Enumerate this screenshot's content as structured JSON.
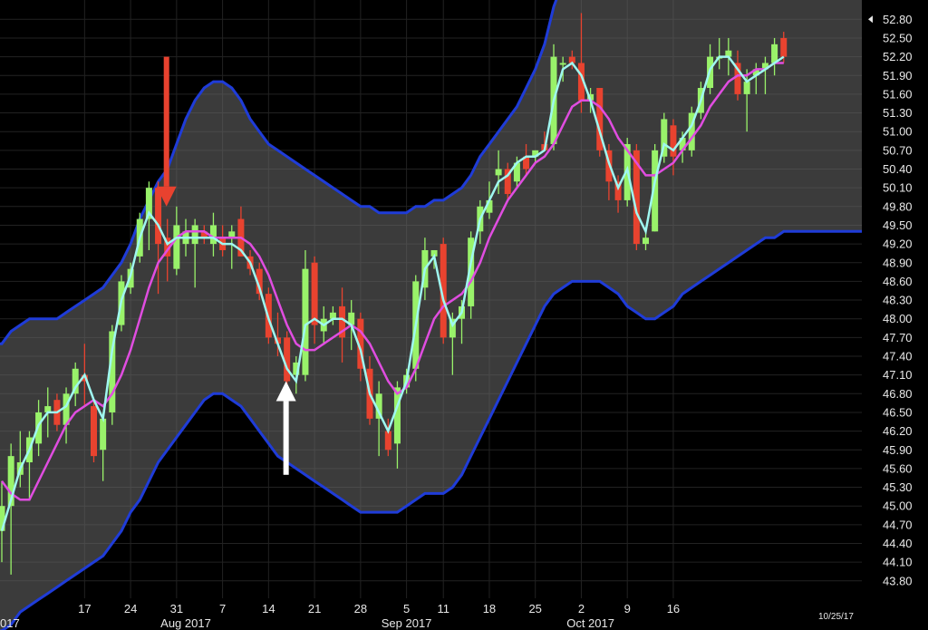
{
  "chart_data": {
    "type": "candlestick",
    "date_label": "10/25/17",
    "y_ticks": [
      "52.80",
      "52.50",
      "52.20",
      "51.90",
      "51.60",
      "51.30",
      "51.00",
      "50.70",
      "50.40",
      "50.10",
      "49.80",
      "49.50",
      "49.20",
      "48.90",
      "48.60",
      "48.30",
      "48.00",
      "47.70",
      "47.40",
      "47.10",
      "46.80",
      "46.50",
      "46.20",
      "45.90",
      "45.60",
      "45.30",
      "45.00",
      "44.70",
      "44.40",
      "44.10",
      "43.80"
    ],
    "ylim": [
      43.6,
      53.4
    ],
    "current_price": 52.8,
    "x_ticks": [
      {
        "label": "17",
        "day": 9
      },
      {
        "label": "24",
        "day": 14
      },
      {
        "label": "31",
        "day": 19
      },
      {
        "label": "7",
        "day": 24
      },
      {
        "label": "14",
        "day": 29
      },
      {
        "label": "21",
        "day": 34
      },
      {
        "label": "28",
        "day": 39
      },
      {
        "label": "5",
        "day": 44
      },
      {
        "label": "11",
        "day": 48
      },
      {
        "label": "18",
        "day": 53
      },
      {
        "label": "25",
        "day": 58
      },
      {
        "label": "2",
        "day": 63
      },
      {
        "label": "9",
        "day": 68
      },
      {
        "label": "16",
        "day": 73
      }
    ],
    "x_months": [
      {
        "label": "017",
        "day": 4
      },
      {
        "label": "Aug 2017",
        "day": 20
      },
      {
        "label": "Sep 2017",
        "day": 44
      },
      {
        "label": "Oct 2017",
        "day": 64
      }
    ],
    "candles": [
      {
        "o": 44.6,
        "h": 45.4,
        "l": 44.1,
        "c": 45.0,
        "up": true
      },
      {
        "o": 45.0,
        "h": 46.0,
        "l": 43.9,
        "c": 45.8,
        "up": true
      },
      {
        "o": 45.5,
        "h": 46.2,
        "l": 45.3,
        "c": 45.7,
        "up": true
      },
      {
        "o": 45.7,
        "h": 46.2,
        "l": 45.1,
        "c": 46.1,
        "up": true
      },
      {
        "o": 46.0,
        "h": 46.7,
        "l": 45.8,
        "c": 46.5,
        "up": true
      },
      {
        "o": 46.5,
        "h": 46.9,
        "l": 46.1,
        "c": 46.6,
        "up": true
      },
      {
        "o": 46.7,
        "h": 46.8,
        "l": 46.2,
        "c": 46.3,
        "up": false
      },
      {
        "o": 46.3,
        "h": 46.9,
        "l": 46.0,
        "c": 46.8,
        "up": true
      },
      {
        "o": 46.8,
        "h": 47.3,
        "l": 46.6,
        "c": 47.2,
        "up": true
      },
      {
        "o": 47.1,
        "h": 47.6,
        "l": 46.6,
        "c": 47.0,
        "up": false
      },
      {
        "o": 46.6,
        "h": 46.7,
        "l": 45.7,
        "c": 45.8,
        "up": false
      },
      {
        "o": 45.9,
        "h": 46.5,
        "l": 45.4,
        "c": 46.4,
        "up": true
      },
      {
        "o": 46.5,
        "h": 47.9,
        "l": 46.3,
        "c": 47.8,
        "up": true
      },
      {
        "o": 47.9,
        "h": 48.7,
        "l": 47.8,
        "c": 48.6,
        "up": true
      },
      {
        "o": 48.5,
        "h": 48.9,
        "l": 48.4,
        "c": 48.8,
        "up": true
      },
      {
        "o": 49.0,
        "h": 49.7,
        "l": 48.9,
        "c": 49.6,
        "up": true
      },
      {
        "o": 49.6,
        "h": 50.2,
        "l": 49.1,
        "c": 50.1,
        "up": true
      },
      {
        "o": 50.1,
        "h": 50.2,
        "l": 48.4,
        "c": 49.2,
        "up": false
      },
      {
        "o": 49.3,
        "h": 49.6,
        "l": 48.6,
        "c": 49.0,
        "up": false
      },
      {
        "o": 48.8,
        "h": 49.8,
        "l": 48.7,
        "c": 49.5,
        "up": true
      },
      {
        "o": 49.2,
        "h": 49.6,
        "l": 49.0,
        "c": 49.4,
        "up": true
      },
      {
        "o": 49.5,
        "h": 49.6,
        "l": 48.5,
        "c": 49.2,
        "up": true
      },
      {
        "o": 49.4,
        "h": 49.5,
        "l": 49.2,
        "c": 49.3,
        "up": false
      },
      {
        "o": 49.5,
        "h": 49.7,
        "l": 49.0,
        "c": 49.2,
        "up": true
      },
      {
        "o": 49.3,
        "h": 49.5,
        "l": 49.0,
        "c": 49.1,
        "up": false
      },
      {
        "o": 49.4,
        "h": 49.5,
        "l": 48.8,
        "c": 49.3,
        "up": true
      },
      {
        "o": 49.6,
        "h": 49.8,
        "l": 49.0,
        "c": 49.0,
        "up": false
      },
      {
        "o": 49.0,
        "h": 49.1,
        "l": 48.7,
        "c": 48.8,
        "up": false
      },
      {
        "o": 48.8,
        "h": 48.9,
        "l": 48.3,
        "c": 48.4,
        "up": false
      },
      {
        "o": 48.4,
        "h": 48.5,
        "l": 47.6,
        "c": 47.7,
        "up": false
      },
      {
        "o": 47.7,
        "h": 48.1,
        "l": 47.4,
        "c": 47.6,
        "up": false
      },
      {
        "o": 47.7,
        "h": 47.8,
        "l": 46.9,
        "c": 47.0,
        "up": false
      },
      {
        "o": 47.1,
        "h": 47.4,
        "l": 46.8,
        "c": 47.3,
        "up": true
      },
      {
        "o": 47.1,
        "h": 49.1,
        "l": 47.0,
        "c": 48.8,
        "up": true
      },
      {
        "o": 48.9,
        "h": 49.0,
        "l": 47.6,
        "c": 47.9,
        "up": false
      },
      {
        "o": 47.8,
        "h": 48.2,
        "l": 47.6,
        "c": 48.0,
        "up": true
      },
      {
        "o": 48.0,
        "h": 48.2,
        "l": 47.9,
        "c": 48.1,
        "up": true
      },
      {
        "o": 48.2,
        "h": 48.5,
        "l": 47.3,
        "c": 47.7,
        "up": false
      },
      {
        "o": 47.9,
        "h": 48.3,
        "l": 47.5,
        "c": 48.1,
        "up": true
      },
      {
        "o": 48.0,
        "h": 48.1,
        "l": 47.0,
        "c": 47.2,
        "up": false
      },
      {
        "o": 47.2,
        "h": 47.4,
        "l": 46.3,
        "c": 46.4,
        "up": false
      },
      {
        "o": 46.4,
        "h": 47.0,
        "l": 45.8,
        "c": 46.8,
        "up": true
      },
      {
        "o": 46.2,
        "h": 46.4,
        "l": 45.8,
        "c": 45.9,
        "up": false
      },
      {
        "o": 46.0,
        "h": 47.0,
        "l": 45.6,
        "c": 46.9,
        "up": true
      },
      {
        "o": 46.9,
        "h": 47.2,
        "l": 46.8,
        "c": 47.1,
        "up": true
      },
      {
        "o": 47.2,
        "h": 48.7,
        "l": 47.0,
        "c": 48.6,
        "up": true
      },
      {
        "o": 48.5,
        "h": 49.3,
        "l": 48.3,
        "c": 49.1,
        "up": true
      },
      {
        "o": 49.0,
        "h": 49.1,
        "l": 48.8,
        "c": 49.1,
        "up": true
      },
      {
        "o": 49.2,
        "h": 49.3,
        "l": 47.6,
        "c": 47.7,
        "up": false
      },
      {
        "o": 47.7,
        "h": 48.1,
        "l": 47.1,
        "c": 48.0,
        "up": true
      },
      {
        "o": 48.0,
        "h": 48.3,
        "l": 47.6,
        "c": 48.2,
        "up": true
      },
      {
        "o": 48.2,
        "h": 49.4,
        "l": 48.0,
        "c": 49.3,
        "up": true
      },
      {
        "o": 49.4,
        "h": 49.9,
        "l": 49.2,
        "c": 49.8,
        "up": true
      },
      {
        "o": 49.7,
        "h": 50.2,
        "l": 49.6,
        "c": 49.9,
        "up": true
      },
      {
        "o": 50.3,
        "h": 50.7,
        "l": 50.0,
        "c": 50.4,
        "up": true
      },
      {
        "o": 50.4,
        "h": 50.5,
        "l": 49.9,
        "c": 50.0,
        "up": false
      },
      {
        "o": 50.2,
        "h": 50.6,
        "l": 50.1,
        "c": 50.5,
        "up": true
      },
      {
        "o": 50.6,
        "h": 50.8,
        "l": 50.3,
        "c": 50.4,
        "up": false
      },
      {
        "o": 50.6,
        "h": 50.7,
        "l": 50.5,
        "c": 50.7,
        "up": true
      },
      {
        "o": 50.8,
        "h": 51.0,
        "l": 50.7,
        "c": 50.7,
        "up": false
      },
      {
        "o": 50.8,
        "h": 52.4,
        "l": 50.7,
        "c": 52.2,
        "up": true
      },
      {
        "o": 52.1,
        "h": 52.2,
        "l": 51.8,
        "c": 52.1,
        "up": true
      },
      {
        "o": 52.2,
        "h": 52.3,
        "l": 52.0,
        "c": 52.1,
        "up": false
      },
      {
        "o": 52.1,
        "h": 52.9,
        "l": 51.3,
        "c": 51.5,
        "up": false
      },
      {
        "o": 51.6,
        "h": 51.7,
        "l": 51.3,
        "c": 51.5,
        "up": true
      },
      {
        "o": 51.7,
        "h": 51.7,
        "l": 50.6,
        "c": 50.7,
        "up": false
      },
      {
        "o": 50.7,
        "h": 50.8,
        "l": 49.9,
        "c": 50.2,
        "up": false
      },
      {
        "o": 50.2,
        "h": 50.3,
        "l": 49.7,
        "c": 49.9,
        "up": false
      },
      {
        "o": 49.9,
        "h": 50.9,
        "l": 49.8,
        "c": 50.8,
        "up": true
      },
      {
        "o": 50.7,
        "h": 50.8,
        "l": 49.1,
        "c": 49.2,
        "up": false
      },
      {
        "o": 49.2,
        "h": 49.4,
        "l": 49.1,
        "c": 49.3,
        "up": true
      },
      {
        "o": 49.4,
        "h": 50.8,
        "l": 49.4,
        "c": 50.7,
        "up": true
      },
      {
        "o": 50.6,
        "h": 51.3,
        "l": 50.5,
        "c": 51.2,
        "up": true
      },
      {
        "o": 51.1,
        "h": 51.2,
        "l": 50.3,
        "c": 50.6,
        "up": false
      },
      {
        "o": 50.7,
        "h": 51.0,
        "l": 50.5,
        "c": 50.9,
        "up": true
      },
      {
        "o": 50.7,
        "h": 51.4,
        "l": 50.6,
        "c": 51.3,
        "up": true
      },
      {
        "o": 51.3,
        "h": 51.8,
        "l": 51.2,
        "c": 51.7,
        "up": true
      },
      {
        "o": 51.7,
        "h": 52.4,
        "l": 51.6,
        "c": 52.2,
        "up": true
      },
      {
        "o": 52.2,
        "h": 52.5,
        "l": 52.0,
        "c": 52.2,
        "up": true
      },
      {
        "o": 52.2,
        "h": 52.5,
        "l": 51.9,
        "c": 52.3,
        "up": true
      },
      {
        "o": 52.1,
        "h": 52.3,
        "l": 51.5,
        "c": 51.6,
        "up": false
      },
      {
        "o": 51.6,
        "h": 52.0,
        "l": 51.0,
        "c": 51.8,
        "up": true
      },
      {
        "o": 51.9,
        "h": 52.1,
        "l": 51.6,
        "c": 52.0,
        "up": true
      },
      {
        "o": 52.0,
        "h": 52.2,
        "l": 51.6,
        "c": 52.1,
        "up": true
      },
      {
        "o": 52.1,
        "h": 52.5,
        "l": 51.9,
        "c": 52.4,
        "up": true
      },
      {
        "o": 52.5,
        "h": 52.6,
        "l": 52.1,
        "c": 52.2,
        "up": false
      }
    ],
    "series": [
      {
        "name": "",
        "color": "#9ff7f0",
        "values": [
          44.6,
          45.1,
          45.6,
          45.9,
          46.3,
          46.5,
          46.5,
          46.6,
          46.9,
          47.1,
          46.7,
          46.4,
          47.5,
          48.3,
          48.7,
          49.3,
          49.7,
          49.5,
          49.2,
          49.3,
          49.3,
          49.3,
          49.3,
          49.3,
          49.2,
          49.2,
          49.1,
          48.9,
          48.5,
          48.0,
          47.6,
          47.2,
          47.0,
          47.9,
          48.0,
          47.9,
          48.0,
          48.0,
          47.9,
          47.5,
          46.8,
          46.5,
          46.2,
          46.6,
          47.0,
          47.9,
          48.8,
          49.0,
          48.3,
          47.9,
          48.1,
          48.9,
          49.6,
          49.9,
          50.2,
          50.3,
          50.5,
          50.6,
          50.6,
          50.7,
          51.5,
          52.0,
          52.1,
          51.9,
          51.5,
          51.0,
          50.5,
          50.1,
          50.4,
          49.7,
          49.4,
          50.2,
          50.8,
          50.7,
          50.9,
          51.1,
          51.5,
          52.0,
          52.2,
          52.2,
          52.0,
          51.8,
          51.9,
          52.0,
          52.1,
          52.2
        ]
      },
      {
        "name": "",
        "color": "#e04de0",
        "values": [
          45.4,
          45.2,
          45.1,
          45.1,
          45.4,
          45.7,
          46.0,
          46.3,
          46.5,
          46.6,
          46.7,
          46.6,
          46.8,
          47.1,
          47.5,
          48.0,
          48.5,
          48.9,
          49.1,
          49.3,
          49.4,
          49.4,
          49.4,
          49.3,
          49.3,
          49.3,
          49.3,
          49.2,
          49.0,
          48.7,
          48.3,
          47.9,
          47.6,
          47.5,
          47.5,
          47.6,
          47.7,
          47.8,
          47.9,
          47.8,
          47.6,
          47.3,
          47.0,
          46.8,
          46.9,
          47.2,
          47.6,
          48.0,
          48.2,
          48.3,
          48.4,
          48.6,
          48.9,
          49.3,
          49.6,
          49.9,
          50.1,
          50.3,
          50.5,
          50.6,
          50.8,
          51.1,
          51.4,
          51.5,
          51.5,
          51.4,
          51.2,
          50.9,
          50.7,
          50.5,
          50.3,
          50.3,
          50.4,
          50.5,
          50.7,
          50.9,
          51.1,
          51.4,
          51.6,
          51.8,
          51.9,
          51.9,
          52.0,
          52.0,
          52.1,
          52.1
        ]
      }
    ],
    "bands": {
      "upper": [
        47.6,
        47.8,
        47.9,
        48.0,
        48.0,
        48.0,
        48.0,
        48.1,
        48.2,
        48.3,
        48.4,
        48.5,
        48.7,
        48.9,
        49.2,
        49.6,
        49.9,
        50.2,
        50.4,
        50.8,
        51.2,
        51.5,
        51.7,
        51.8,
        51.8,
        51.7,
        51.5,
        51.2,
        51.0,
        50.8,
        50.7,
        50.6,
        50.5,
        50.4,
        50.3,
        50.2,
        50.1,
        50.0,
        49.9,
        49.8,
        49.8,
        49.7,
        49.7,
        49.7,
        49.7,
        49.8,
        49.8,
        49.9,
        49.9,
        50.0,
        50.1,
        50.3,
        50.6,
        50.8,
        51.0,
        51.2,
        51.4,
        51.7,
        52.0,
        52.4,
        53.0,
        53.4,
        53.4,
        53.4,
        53.4,
        53.4,
        53.4,
        53.4,
        53.4,
        53.4,
        53.4,
        53.4,
        53.4,
        53.4,
        53.4,
        53.4,
        53.4,
        53.4,
        53.4,
        53.4,
        53.4,
        53.4,
        53.4,
        53.4,
        53.4,
        53.4
      ],
      "lower": [
        43.0,
        43.1,
        43.3,
        43.4,
        43.5,
        43.6,
        43.7,
        43.8,
        43.9,
        44.0,
        44.1,
        44.2,
        44.4,
        44.6,
        44.9,
        45.1,
        45.4,
        45.7,
        45.9,
        46.1,
        46.3,
        46.5,
        46.7,
        46.8,
        46.8,
        46.7,
        46.6,
        46.4,
        46.2,
        46.0,
        45.8,
        45.7,
        45.6,
        45.5,
        45.4,
        45.3,
        45.2,
        45.1,
        45.0,
        44.9,
        44.9,
        44.9,
        44.9,
        44.9,
        45.0,
        45.1,
        45.2,
        45.2,
        45.2,
        45.3,
        45.5,
        45.8,
        46.1,
        46.4,
        46.7,
        47.0,
        47.3,
        47.6,
        47.9,
        48.2,
        48.4,
        48.5,
        48.6,
        48.6,
        48.6,
        48.6,
        48.5,
        48.4,
        48.2,
        48.1,
        48.0,
        48.0,
        48.1,
        48.2,
        48.4,
        48.5,
        48.6,
        48.7,
        48.8,
        48.9,
        49.0,
        49.1,
        49.2,
        49.3,
        49.3,
        49.4
      ]
    },
    "arrows": [
      {
        "color": "#e8422f",
        "direction": "down",
        "day": 18,
        "from": 52.2,
        "to": 49.8
      },
      {
        "color": "#ffffff",
        "direction": "up",
        "day": 31,
        "from": 45.5,
        "to": 47.0
      }
    ],
    "colors": {
      "up": "#99f26a",
      "down": "#e8432f",
      "band": "#1f3cd8",
      "band_fill": "#3b3b3b",
      "background": "#000000"
    }
  }
}
